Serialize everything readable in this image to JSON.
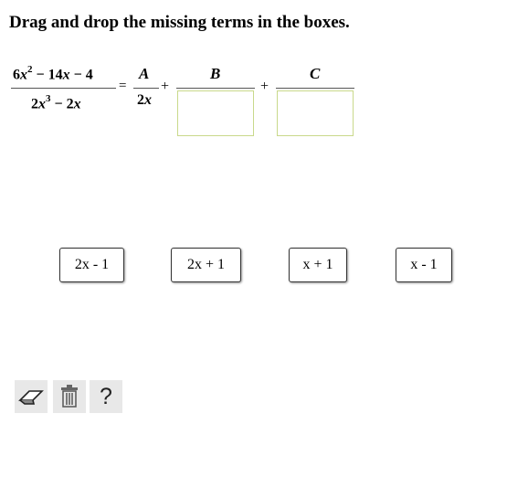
{
  "instruction": "Drag and drop the missing terms in the boxes.",
  "equation": {
    "lhs_numerator": "6x² − 14x − 4",
    "lhs_denominator": "2x³ − 2x",
    "equals": "=",
    "term1_numerator": "A",
    "term1_denominator": "2x",
    "plus": "+",
    "term2_numerator": "B",
    "term3_numerator": "C"
  },
  "tiles": [
    "2x - 1",
    "2x + 1",
    "x + 1",
    "x - 1"
  ],
  "toolbar": {
    "eraser_icon": "eraser-icon",
    "trash_icon": "trash-icon",
    "help_label": "?"
  }
}
